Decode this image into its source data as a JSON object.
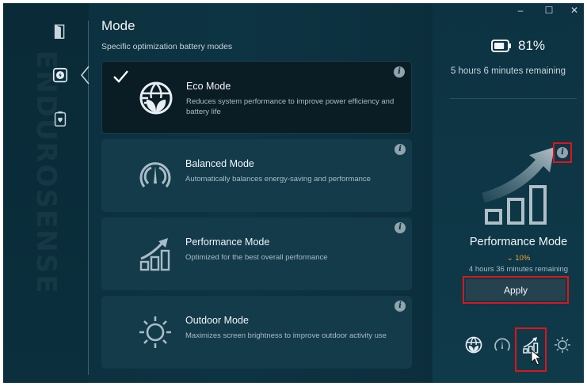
{
  "sidebar": {
    "watermark": "ENDUROSENSE",
    "items": [
      {
        "name": "shield",
        "icon": "door-icon"
      },
      {
        "name": "battery-mode",
        "icon": "bolt-battery-icon",
        "active": true
      },
      {
        "name": "battery-health",
        "icon": "heart-battery-icon"
      }
    ]
  },
  "header": {
    "title": "Mode",
    "subtitle": "Specific optimization battery modes"
  },
  "modes": [
    {
      "name": "Eco Mode",
      "description": "Reduces system performance to improve power efficiency and battery life",
      "icon": "globe-leaf-icon",
      "selected": true
    },
    {
      "name": "Balanced Mode",
      "description": "Automatically balances energy-saving and performance",
      "icon": "gauge-icon",
      "selected": false
    },
    {
      "name": "Performance Mode",
      "description": "Optimized for the best overall performance",
      "icon": "bars-arrow-icon",
      "selected": false
    },
    {
      "name": "Outdoor Mode",
      "description": "Maximizes screen brightness to improve outdoor activity use",
      "icon": "sun-icon",
      "selected": false
    }
  ],
  "info_glyph": "i",
  "window_controls": {
    "minimize": "–",
    "maximize": "☐",
    "close": "✕"
  },
  "status": {
    "battery_percent": "81%",
    "battery_level": 0.81,
    "remaining": "5 hours 6 minutes remaining"
  },
  "selected_panel": {
    "mode_name": "Performance Mode",
    "boost_arrow": "⌄",
    "boost_value": "10%",
    "remaining": "4 hours 36 minutes remaining",
    "apply_label": "Apply"
  },
  "quick_modes": [
    "globe-leaf-icon",
    "gauge-icon",
    "bars-arrow-icon",
    "sun-icon"
  ],
  "colors": {
    "accent_highlight": "#e0141a",
    "boost": "#f0a52a",
    "background": "#0d3443"
  }
}
